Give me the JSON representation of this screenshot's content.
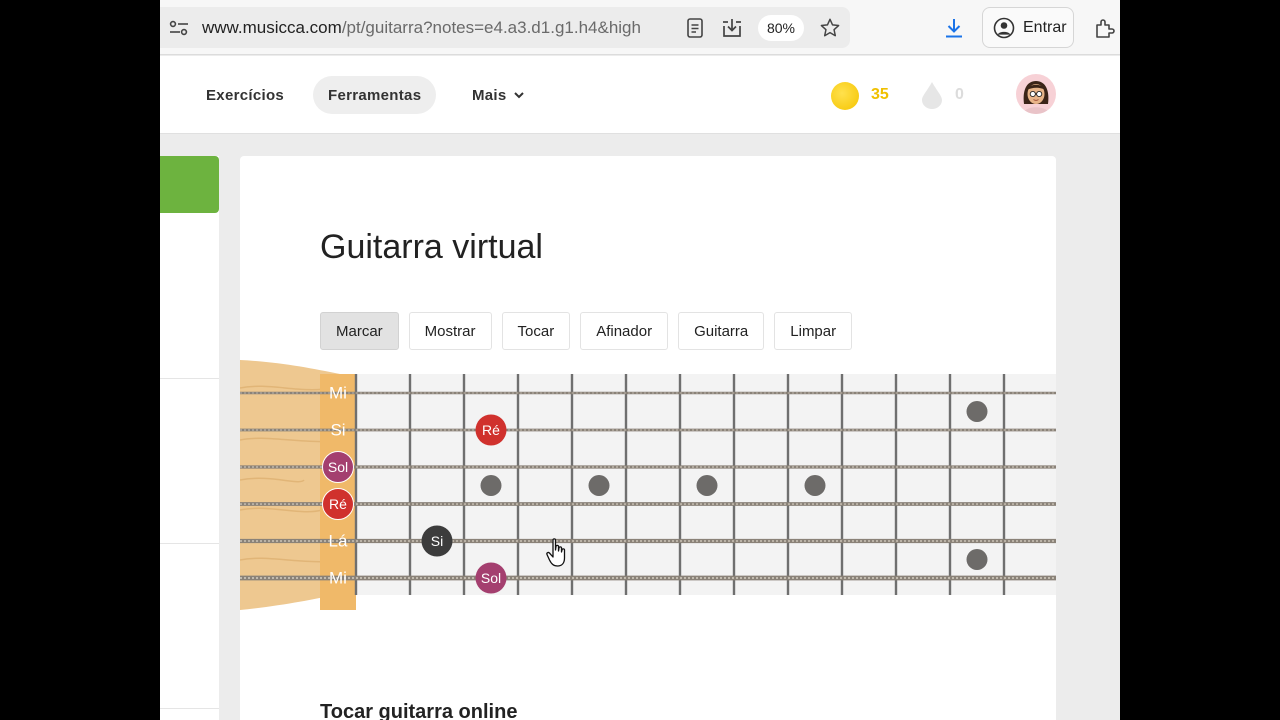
{
  "browser": {
    "url_host": "www.musicca.com",
    "url_path": "/pt/guitarra?notes=e4.a3.d1.g1.h4&high",
    "zoom": "80%",
    "signin_label": "Entrar"
  },
  "header": {
    "nav": [
      {
        "label": "Exercícios"
      },
      {
        "label": "Ferramentas"
      },
      {
        "label": "Mais"
      }
    ],
    "coins": "35",
    "drops": "0"
  },
  "main": {
    "title": "Guitarra virtual",
    "tools": [
      {
        "label": "Marcar",
        "active": true
      },
      {
        "label": "Mostrar"
      },
      {
        "label": "Tocar"
      },
      {
        "label": "Afinador"
      },
      {
        "label": "Guitarra"
      },
      {
        "label": "Limpar"
      }
    ],
    "section_heading": "Tocar guitarra online"
  },
  "fretboard": {
    "strings": [
      "Mi",
      "Si",
      "Sol",
      "Ré",
      "Lá",
      "Mi"
    ],
    "open_highlighted": [
      {
        "string": 3,
        "label": "Sol",
        "color": "#a43f6f"
      },
      {
        "string": 4,
        "label": "Ré",
        "color": "#d0312d"
      }
    ],
    "marked_notes": [
      {
        "string": 2,
        "fret": 3,
        "label": "Ré",
        "color": "#d0312d"
      },
      {
        "string": 5,
        "fret": 2,
        "label": "Si",
        "color": "#3c3c3c"
      },
      {
        "string": 6,
        "fret": 3,
        "label": "Sol",
        "color": "#a43f6f"
      }
    ],
    "inlay_frets_single": [
      3,
      5,
      7,
      9
    ],
    "inlay_fret_double": 12,
    "colors": {
      "marker_gray": "#6d6b69",
      "headstock": "#eec890",
      "nut": "#f0b969",
      "board": "#f3f3f3"
    }
  }
}
